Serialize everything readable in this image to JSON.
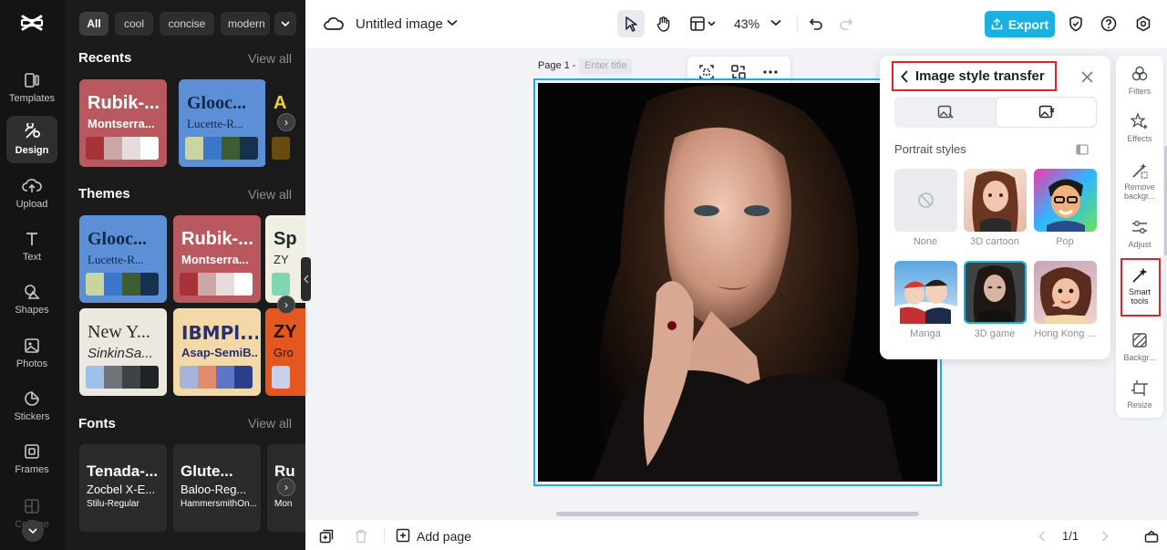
{
  "rail": {
    "items": [
      {
        "label": "Templates",
        "icon": "templates-icon"
      },
      {
        "label": "Design",
        "icon": "design-icon"
      },
      {
        "label": "Upload",
        "icon": "upload-icon"
      },
      {
        "label": "Text",
        "icon": "text-icon"
      },
      {
        "label": "Shapes",
        "icon": "shapes-icon"
      },
      {
        "label": "Photos",
        "icon": "photos-icon"
      },
      {
        "label": "Stickers",
        "icon": "stickers-icon"
      },
      {
        "label": "Frames",
        "icon": "frames-icon"
      },
      {
        "label": "Collage",
        "icon": "collage-icon"
      }
    ],
    "active": "Design"
  },
  "panel": {
    "chips": [
      "All",
      "cool",
      "concise",
      "modern"
    ],
    "recents": {
      "title": "Recents",
      "view_all": "View all",
      "cards": [
        {
          "t1": "Rubik-...",
          "t2": "Montserra...",
          "bg": "#b9585e",
          "fg": "#ffffff",
          "swatches": [
            "#a8323a",
            "#c9a7a7",
            "#e6dcdc",
            "#ffffff"
          ]
        },
        {
          "t1": "Glooc...",
          "t2": "Lucette-R...",
          "bg": "#5d8fd6",
          "fg": "#0e2a4a",
          "swatches": [
            "#cbd3a1",
            "#3b78c9",
            "#3e5c2f",
            "#14314f"
          ]
        },
        {
          "t1": "A",
          "t2": "",
          "bg": "#1a1a1a",
          "fg": "#f3d13a",
          "swatches": [
            "#6b4a0f"
          ]
        }
      ]
    },
    "themes": {
      "title": "Themes",
      "view_all": "View all",
      "cards": [
        {
          "t1": "Glooc...",
          "t2": "Lucette-R...",
          "bg": "#5d8fd6",
          "fg": "#0e2a4a",
          "swatches": [
            "#cbd3a1",
            "#3b78c9",
            "#3e5c2f",
            "#14314f"
          ]
        },
        {
          "t1": "Rubik-...",
          "t2": "Montserra...",
          "bg": "#b9585e",
          "fg": "#ffffff",
          "swatches": [
            "#a8323a",
            "#c9a7a7",
            "#e6dcdc",
            "#ffffff"
          ]
        },
        {
          "t1": "Sp",
          "t2": "ZY",
          "bg": "#f1efe4",
          "fg": "#1f2d2a",
          "swatches": [
            "#7fd6b1"
          ]
        },
        {
          "t1": "New Y...",
          "t2": "SinkinSa...",
          "bg": "#ece8e0",
          "fg": "#2a2a2a",
          "swatches": [
            "#9cc0e9",
            "#6f7478",
            "#3f4346",
            "#1f2326"
          ]
        },
        {
          "t1": "IBMPl...",
          "t2": "Asap-SemiB...",
          "bg": "#f4d9a8",
          "fg": "#2b2f6a",
          "swatches": [
            "#a8b3d8",
            "#e08b6c",
            "#5d76c9",
            "#2e3f8a"
          ]
        },
        {
          "t1": "ZY",
          "t2": "Gro",
          "bg": "#e4571f",
          "fg": "#2a1005",
          "swatches": [
            "#c9d1ea"
          ]
        }
      ]
    },
    "fonts": {
      "title": "Fonts",
      "view_all": "View all",
      "cards": [
        {
          "f1": "Tenada-...",
          "f2": "Zocbel X-E...",
          "f3": "Stilu-Regular"
        },
        {
          "f1": "Glute...",
          "f2": "Baloo-Reg...",
          "f3": "HammersmithOn..."
        },
        {
          "f1": "Ru",
          "f2": "",
          "f3": "Mon"
        }
      ]
    }
  },
  "topbar": {
    "doc_title": "Untitled image",
    "zoom": "43%",
    "export_label": "Export"
  },
  "canvas": {
    "page_label": "Page 1 -",
    "title_placeholder": "Enter title"
  },
  "style_panel": {
    "title": "Image style transfer",
    "section": "Portrait styles",
    "styles": [
      {
        "label": "None",
        "icon": "none-icon"
      },
      {
        "label": "3D cartoon",
        "icon": "3d-cartoon-thumbnail"
      },
      {
        "label": "Pop",
        "icon": "pop-thumbnail"
      },
      {
        "label": "Manga",
        "icon": "manga-thumbnail"
      },
      {
        "label": "3D game",
        "icon": "3d-game-thumbnail"
      },
      {
        "label": "Hong Kong ...",
        "icon": "hong-kong-thumbnail"
      }
    ],
    "selected": "3D game"
  },
  "right_rail": {
    "items": [
      {
        "label": "Filters",
        "icon": "filters-icon"
      },
      {
        "label": "Effects",
        "icon": "effects-icon"
      },
      {
        "label": "Remove backgr...",
        "icon": "remove-background-icon"
      },
      {
        "label": "Adjust",
        "icon": "adjust-icon"
      },
      {
        "label": "Smart tools",
        "icon": "smart-tools-icon"
      },
      {
        "label": "Backgr...",
        "icon": "background-icon"
      },
      {
        "label": "Resize",
        "icon": "resize-icon"
      }
    ]
  },
  "bottombar": {
    "add_page": "Add page",
    "page_count": "1/1"
  },
  "colors": {
    "accent": "#1ab0e0",
    "highlight": "#e0242b",
    "rail_bg": "#141414",
    "panel_bg": "#1b1b1b"
  }
}
